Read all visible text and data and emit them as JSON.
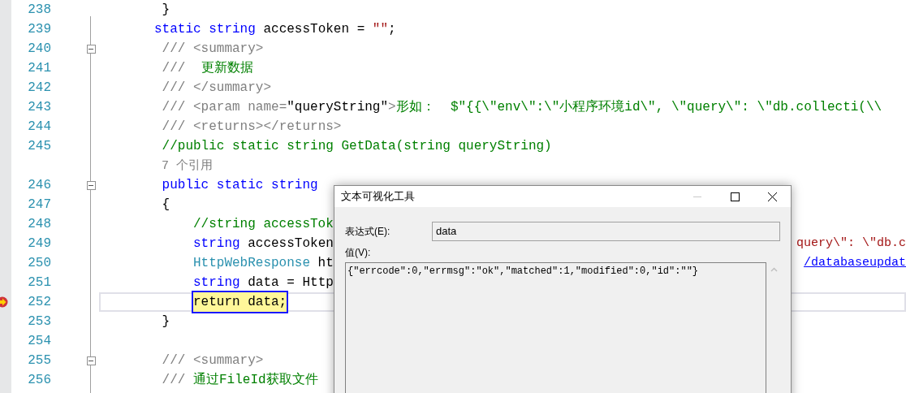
{
  "editor": {
    "lines": [
      {
        "kind": "code",
        "number": "238",
        "foldable": false,
        "current": false,
        "segments": [
          {
            "kind": "plain",
            "text": " }"
          }
        ]
      },
      {
        "kind": "code",
        "number": "239",
        "foldable": false,
        "current": false,
        "segments": [
          {
            "kind": "keyword",
            "text": "static string"
          },
          {
            "kind": "plain",
            "text": " accessToken = "
          },
          {
            "kind": "string",
            "text": "\"\""
          },
          {
            "kind": "plain",
            "text": ";"
          }
        ]
      },
      {
        "kind": "code",
        "number": "240",
        "foldable": true,
        "current": false,
        "segments": [
          {
            "kind": "doc",
            "text": " /// <summary>"
          }
        ]
      },
      {
        "kind": "code",
        "number": "241",
        "foldable": false,
        "current": false,
        "segments": [
          {
            "kind": "doc",
            "text": " ///  "
          },
          {
            "kind": "comment",
            "text": "更新数据"
          }
        ]
      },
      {
        "kind": "code",
        "number": "242",
        "foldable": false,
        "current": false,
        "segments": [
          {
            "kind": "doc",
            "text": " /// </summary>"
          }
        ]
      },
      {
        "kind": "code",
        "number": "243",
        "foldable": false,
        "current": false,
        "segments": [
          {
            "kind": "doc",
            "text": " /// <param name="
          },
          {
            "kind": "plain",
            "text": "\"queryString\""
          },
          {
            "kind": "doc",
            "text": ">"
          },
          {
            "kind": "comment",
            "text": "形如：  $\"{{\\\"env\\\":\\\"小程序环境id\\\", \\\"query\\\": \\\"db.collecti(\\\\"
          }
        ]
      },
      {
        "kind": "code",
        "number": "244",
        "foldable": false,
        "current": false,
        "segments": [
          {
            "kind": "doc",
            "text": " /// <returns></returns>"
          }
        ]
      },
      {
        "kind": "code",
        "number": "245",
        "foldable": false,
        "current": false,
        "segments": [
          {
            "kind": "comment",
            "text": " //public static string GetData(string queryString)"
          }
        ]
      },
      {
        "kind": "codelens",
        "text": " 7 个引用"
      },
      {
        "kind": "code",
        "number": "246",
        "foldable": true,
        "current": false,
        "segments": [
          {
            "kind": "keyword",
            "text": " public static string"
          }
        ]
      },
      {
        "kind": "code",
        "number": "247",
        "foldable": false,
        "current": false,
        "segments": [
          {
            "kind": "plain",
            "text": " {"
          }
        ],
        "children": [
          {
            "kind": "code",
            "number": "248",
            "foldable": false,
            "current": false,
            "segments": [
              {
                "kind": "comment",
                "text": " //string accessTok"
              }
            ]
          },
          {
            "kind": "code",
            "number": "249",
            "foldable": false,
            "current": false,
            "segments": [
              {
                "kind": "keyword",
                "text": " string"
              },
              {
                "kind": "plain",
                "text": " accessToken"
              }
            ],
            "tail": [
              {
                "kind": "string",
                "text": "query\\\": \\\"db.c"
              }
            ]
          },
          {
            "kind": "code",
            "number": "250",
            "foldable": false,
            "current": false,
            "segments": [
              {
                "kind": "type",
                "text": " HttpWebResponse"
              },
              {
                "kind": "plain",
                "text": " ht"
              }
            ],
            "tail": [
              {
                "kind": "link",
                "text": "/databaseupdat"
              }
            ]
          },
          {
            "kind": "code",
            "number": "251",
            "foldable": false,
            "current": false,
            "segments": [
              {
                "kind": "keyword",
                "text": " string"
              },
              {
                "kind": "plain",
                "text": " data = Http"
              }
            ]
          },
          {
            "kind": "code",
            "number": "252",
            "foldable": false,
            "current": true,
            "segments": [
              {
                "kind": "statement",
                "text": "return data;"
              }
            ]
          }
        ]
      },
      {
        "kind": "code",
        "number": "253",
        "foldable": false,
        "current": false,
        "segments": [
          {
            "kind": "plain",
            "text": " }"
          }
        ]
      },
      {
        "kind": "code",
        "number": "254",
        "foldable": false,
        "current": false
      },
      {
        "kind": "code",
        "number": "255",
        "foldable": true,
        "current": false,
        "segments": [
          {
            "kind": "doc",
            "text": " /// <summary>"
          }
        ]
      },
      {
        "kind": "code",
        "number": "256",
        "foldable": false,
        "current": false,
        "segments": [
          {
            "kind": "doc",
            "text": " /// "
          },
          {
            "kind": "comment",
            "text": "通过FileId获取文件"
          }
        ]
      }
    ]
  },
  "dialog": {
    "title": "文本可视化工具",
    "expression_label": "表达式(E):",
    "expression": "data",
    "value_label": "值(V):",
    "value": "{\"errcode\":0,\"errmsg\":\"ok\",\"matched\":1,\"modified\":0,\"id\":\"\"}"
  }
}
